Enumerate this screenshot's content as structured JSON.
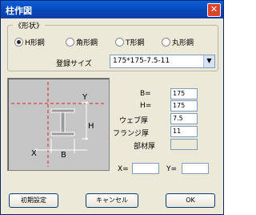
{
  "window": {
    "title": "柱作図",
    "close_glyph": "✕"
  },
  "shape_group": {
    "legend": "《形状》",
    "options": [
      {
        "label": "H形鋼",
        "selected": true
      },
      {
        "label": "角形鋼",
        "selected": false
      },
      {
        "label": "T形鋼",
        "selected": false
      },
      {
        "label": "丸形鋼",
        "selected": false
      }
    ],
    "size_label": "登録サイズ",
    "size_value": "175*175-7.5-11"
  },
  "diagram": {
    "label_x": "X",
    "label_y": "Y",
    "label_b": "B",
    "label_h": "H"
  },
  "params": {
    "b_label": "B=",
    "b_value": "175",
    "h_label": "H=",
    "h_value": "175",
    "web_label": "ウェブ厚",
    "web_value": "7.5",
    "flange_label": "フランジ厚",
    "flange_value": "11",
    "member_label": "部材厚",
    "member_value": ""
  },
  "coords": {
    "x_label": "X=",
    "x_value": "",
    "y_label": "Y=",
    "y_value": ""
  },
  "buttons": {
    "reset": "初期設定",
    "cancel": "キャンセル",
    "ok": "OK"
  }
}
